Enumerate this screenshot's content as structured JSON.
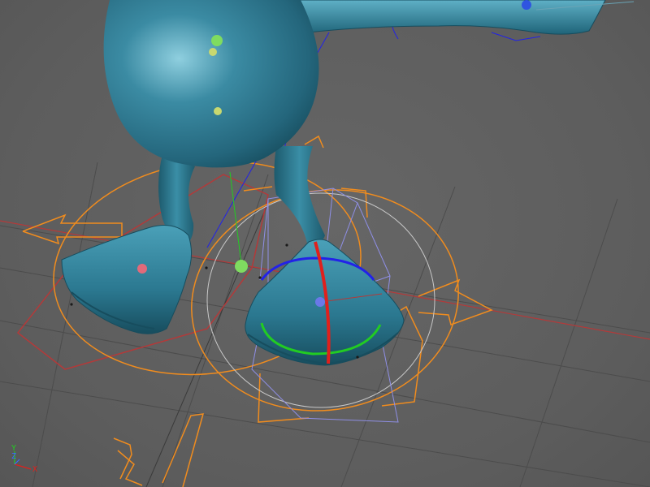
{
  "viewport": {
    "background": "#5e5e5e",
    "grid_color": "#4c4c4c"
  },
  "character": {
    "body_color": "#2f7e96",
    "body_dark": "#1d566a",
    "body_light": "#7fc2d4"
  },
  "gizmos": {
    "move_handle_color": "#f08c1e",
    "rotate_x_color": "#e0201c",
    "rotate_y_color": "#22cc22",
    "rotate_z_color": "#2222e8",
    "bound_box_color": "#8f8fe6",
    "selection_color": "#b23a3a",
    "outer_ring_color": "#c9c9c9"
  },
  "axis_gizmo": {
    "y_label": "Y",
    "z_label": "Z",
    "x_label": "X",
    "y_color": "#22cc22",
    "z_color": "#3a6bff",
    "x_color": "#e0201c"
  }
}
